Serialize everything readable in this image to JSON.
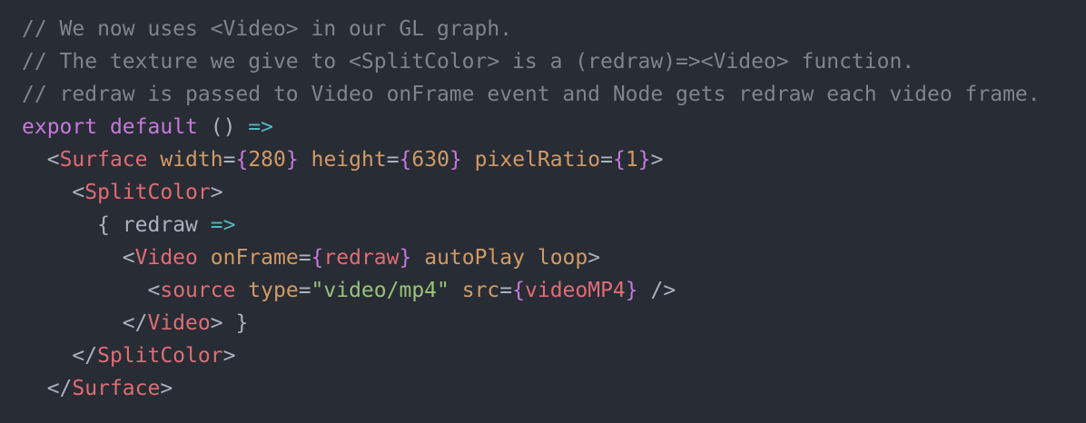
{
  "theme": {
    "background": "#282c34",
    "comment": "#7f848e",
    "keyword": "#c678dd",
    "tag": "#e06c75",
    "attribute": "#d19a66",
    "string": "#98c379",
    "operator": "#56b6c2",
    "plain": "#abb2bf"
  },
  "code": {
    "lines": [
      {
        "tokens": [
          {
            "t": "comment",
            "v": "// We now uses <Video> in our GL graph."
          }
        ]
      },
      {
        "tokens": [
          {
            "t": "comment",
            "v": "// The texture we give to <SplitColor> is a (redraw)=><Video> function."
          }
        ]
      },
      {
        "tokens": [
          {
            "t": "comment",
            "v": "// redraw is passed to Video onFrame event and Node gets redraw each video frame."
          }
        ]
      },
      {
        "tokens": [
          {
            "t": "keyword",
            "v": "export"
          },
          {
            "t": "plain",
            "v": " "
          },
          {
            "t": "keyword",
            "v": "default"
          },
          {
            "t": "plain",
            "v": " () "
          },
          {
            "t": "arrow",
            "v": "=>"
          }
        ]
      },
      {
        "tokens": [
          {
            "t": "plain",
            "v": "  "
          },
          {
            "t": "tag-bracket",
            "v": "<"
          },
          {
            "t": "tag",
            "v": "Surface"
          },
          {
            "t": "plain",
            "v": " "
          },
          {
            "t": "attr",
            "v": "width"
          },
          {
            "t": "punct",
            "v": "="
          },
          {
            "t": "brace",
            "v": "{"
          },
          {
            "t": "number",
            "v": "280"
          },
          {
            "t": "brace",
            "v": "}"
          },
          {
            "t": "plain",
            "v": " "
          },
          {
            "t": "attr",
            "v": "height"
          },
          {
            "t": "punct",
            "v": "="
          },
          {
            "t": "brace",
            "v": "{"
          },
          {
            "t": "number",
            "v": "630"
          },
          {
            "t": "brace",
            "v": "}"
          },
          {
            "t": "plain",
            "v": " "
          },
          {
            "t": "attr",
            "v": "pixelRatio"
          },
          {
            "t": "punct",
            "v": "="
          },
          {
            "t": "brace",
            "v": "{"
          },
          {
            "t": "number",
            "v": "1"
          },
          {
            "t": "brace",
            "v": "}"
          },
          {
            "t": "tag-bracket",
            "v": ">"
          }
        ]
      },
      {
        "tokens": [
          {
            "t": "plain",
            "v": "    "
          },
          {
            "t": "tag-bracket",
            "v": "<"
          },
          {
            "t": "tag",
            "v": "SplitColor"
          },
          {
            "t": "tag-bracket",
            "v": ">"
          }
        ]
      },
      {
        "tokens": [
          {
            "t": "plain",
            "v": "      "
          },
          {
            "t": "punct",
            "v": "{"
          },
          {
            "t": "plain",
            "v": " redraw "
          },
          {
            "t": "arrow",
            "v": "=>"
          }
        ]
      },
      {
        "tokens": [
          {
            "t": "plain",
            "v": "        "
          },
          {
            "t": "tag-bracket",
            "v": "<"
          },
          {
            "t": "tag",
            "v": "Video"
          },
          {
            "t": "plain",
            "v": " "
          },
          {
            "t": "attr",
            "v": "onFrame"
          },
          {
            "t": "punct",
            "v": "="
          },
          {
            "t": "brace",
            "v": "{"
          },
          {
            "t": "var",
            "v": "redraw"
          },
          {
            "t": "brace",
            "v": "}"
          },
          {
            "t": "plain",
            "v": " "
          },
          {
            "t": "attr",
            "v": "autoPlay"
          },
          {
            "t": "plain",
            "v": " "
          },
          {
            "t": "attr",
            "v": "loop"
          },
          {
            "t": "tag-bracket",
            "v": ">"
          }
        ]
      },
      {
        "tokens": [
          {
            "t": "plain",
            "v": "          "
          },
          {
            "t": "tag-bracket",
            "v": "<"
          },
          {
            "t": "tag",
            "v": "source"
          },
          {
            "t": "plain",
            "v": " "
          },
          {
            "t": "attr",
            "v": "type"
          },
          {
            "t": "punct",
            "v": "="
          },
          {
            "t": "string",
            "v": "\"video/mp4\""
          },
          {
            "t": "plain",
            "v": " "
          },
          {
            "t": "attr",
            "v": "src"
          },
          {
            "t": "punct",
            "v": "="
          },
          {
            "t": "brace",
            "v": "{"
          },
          {
            "t": "var",
            "v": "videoMP4"
          },
          {
            "t": "brace",
            "v": "}"
          },
          {
            "t": "plain",
            "v": " "
          },
          {
            "t": "tag-bracket",
            "v": "/>"
          }
        ]
      },
      {
        "tokens": [
          {
            "t": "plain",
            "v": "        "
          },
          {
            "t": "tag-bracket",
            "v": "</"
          },
          {
            "t": "tag",
            "v": "Video"
          },
          {
            "t": "tag-bracket",
            "v": ">"
          },
          {
            "t": "plain",
            "v": " "
          },
          {
            "t": "punct",
            "v": "}"
          }
        ]
      },
      {
        "tokens": [
          {
            "t": "plain",
            "v": "    "
          },
          {
            "t": "tag-bracket",
            "v": "</"
          },
          {
            "t": "tag",
            "v": "SplitColor"
          },
          {
            "t": "tag-bracket",
            "v": ">"
          }
        ]
      },
      {
        "tokens": [
          {
            "t": "plain",
            "v": "  "
          },
          {
            "t": "tag-bracket",
            "v": "</"
          },
          {
            "t": "tag",
            "v": "Surface"
          },
          {
            "t": "tag-bracket",
            "v": ">"
          }
        ]
      }
    ]
  }
}
